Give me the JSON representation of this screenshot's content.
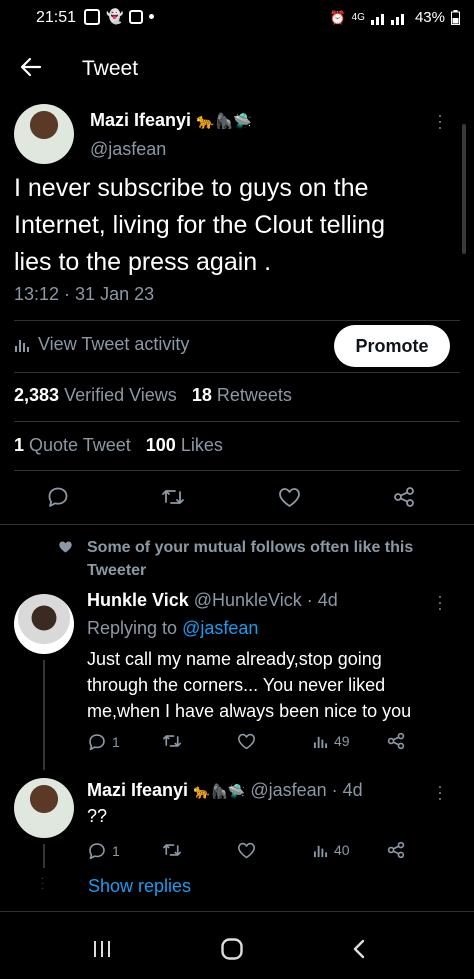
{
  "status_bar": {
    "time": "21:51",
    "network": "4G",
    "battery": "43%"
  },
  "header": {
    "title": "Tweet",
    "back_icon": "arrow-left-icon"
  },
  "tweet": {
    "author_name": "Mazi Ifeanyi",
    "author_emoji": "🐆🦍🛸",
    "handle": "@jasfean",
    "text_lines": [
      "I never subscribe to guys on the",
      "Internet, living for the Clout telling",
      "lies to the press again ."
    ],
    "timestamp": "13:12 · 31 Jan 23",
    "activity_label": "View Tweet activity",
    "promote_label": "Promote",
    "views_count": "2,383",
    "views_label": "Verified Views",
    "retweets_count": "18",
    "retweets_label": "Retweets",
    "quotes_count": "1",
    "quotes_label": "Quote Tweet",
    "likes_count": "100",
    "likes_label": "Likes"
  },
  "social_context": {
    "text_line1": "Some of your mutual follows often like this",
    "text_line2": "Tweeter"
  },
  "replies": [
    {
      "name": "Hunkle Vick",
      "handle_time": "@HunkleVick · 4d",
      "replying_prefix": "Replying to",
      "replying_to": "@jasfean",
      "text_lines": [
        "Just call my name already,stop going",
        "through the corners... You never liked",
        "me,when I have always been nice to you"
      ],
      "reply_count": "1",
      "views_count": "49"
    },
    {
      "name": "Mazi Ifeanyi",
      "emoji": "🐆🦍🛸",
      "handle_time": "@jasfean · 4d",
      "text": "??",
      "reply_count": "1",
      "views_count": "40"
    }
  ],
  "show_replies_label": "Show replies",
  "colors": {
    "background": "#000000",
    "accent": "#1d9bf0",
    "muted": "#8b98a5",
    "divider": "#2f3336"
  }
}
